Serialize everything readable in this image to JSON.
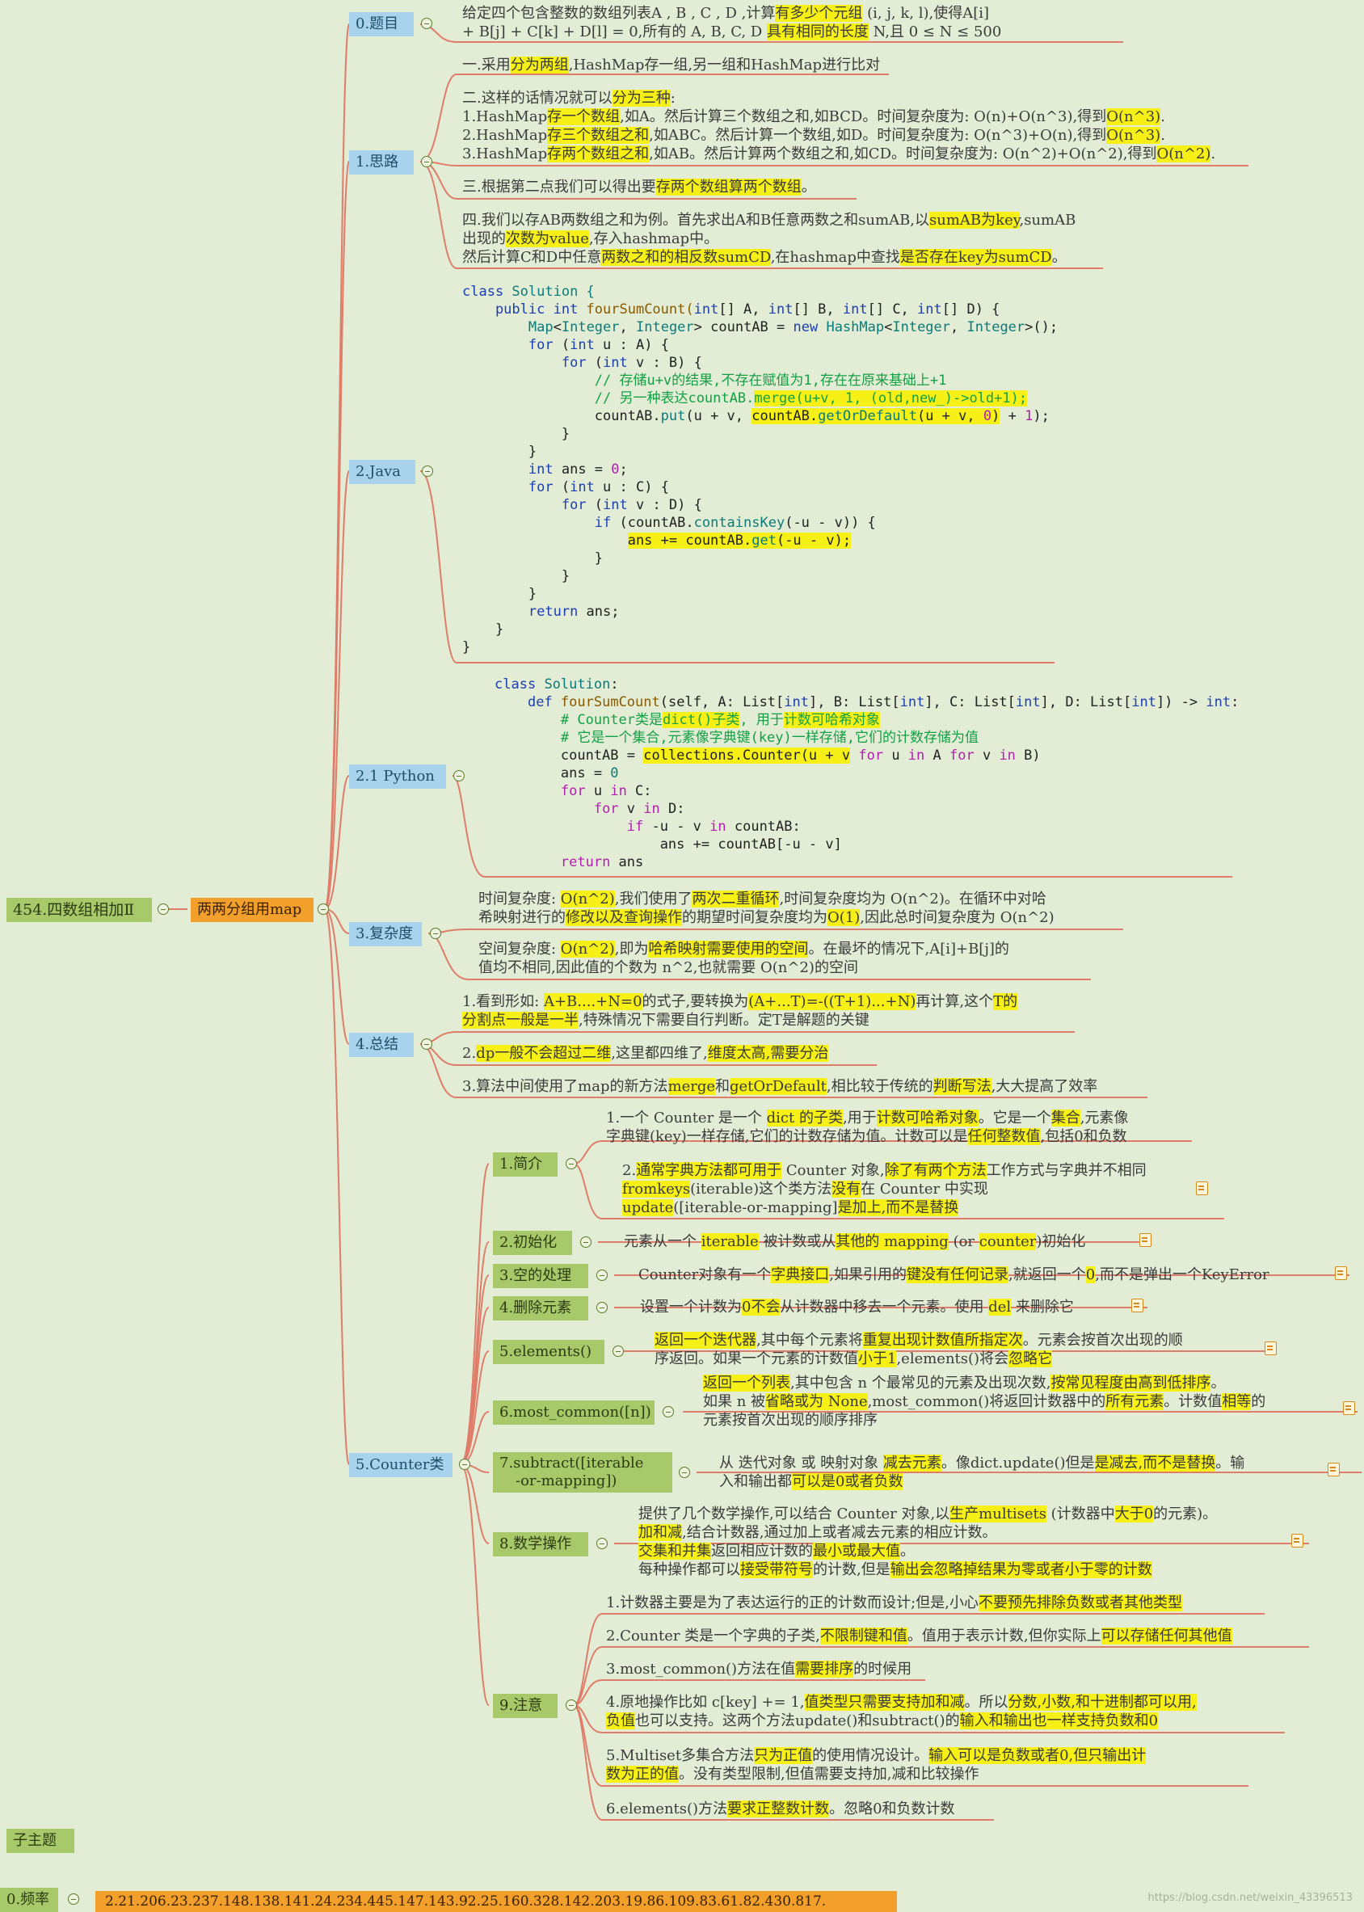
{
  "root": {
    "label": "454.四数组相加Ⅱ"
  },
  "hub": {
    "label": "两两分组用map"
  },
  "branches": {
    "title": "0.题目",
    "idea": "1.思路",
    "java": "2.Java",
    "python": "2.1 Python",
    "complexity": "3.复杂度",
    "summary": "4.总结",
    "counter": "5.Counter类"
  },
  "title_text": {
    "l1a": "给定四个包含整数的数组列表A , B , C , D ,计算",
    "l1b": "有多少个元组",
    "l1c": " (i, j, k, l),使得A[i]",
    "l2a": "+ B[j] + C[k] + D[l] = 0,所有的 A, B, C, D ",
    "l2b": "具有相同的长度",
    "l2c": " N,且 0 ≤ N ≤ 500"
  },
  "idea_text": {
    "p1a": "一.采用",
    "p1b": "分为两组",
    "p1c": ",HashMap存一组,另一组和HashMap进行比对",
    "p2a": "二.这样的话情况就可以",
    "p2b": "分为三种",
    "p2c": ":",
    "p2_1a": "1.HashMap",
    "p2_1b": "存一个数组",
    "p2_1c": ",如A。然后计算三个数组之和,如BCD。时间复杂度为: O(n)+O(n^3),得到",
    "p2_1d": "O(n^3)",
    "p2_1e": ".",
    "p2_2a": "2.HashMap",
    "p2_2b": "存三个数组之和",
    "p2_2c": ",如ABC。然后计算一个数组,如D。时间复杂度为: O(n^3)+O(n),得到",
    "p2_2d": "O(n^3)",
    "p2_2e": ".",
    "p2_3a": "3.HashMap",
    "p2_3b": "存两个数组之和",
    "p2_3c": ",如AB。然后计算两个数组之和,如CD。时间复杂度为: O(n^2)+O(n^2),得到",
    "p2_3d": "O(n^2)",
    "p2_3e": ".",
    "p3a": "三.根据第二点我们可以得出要",
    "p3b": "存两个数组算两个数组",
    "p3c": "。",
    "p4a": "四.我们以存AB两数组之和为例。首先求出A和B任意两数之和sumAB,以",
    "p4b": "sumAB为key",
    "p4c": ",sumAB",
    "p4d": "出现的",
    "p4e": "次数为value",
    "p4f": ",存入hashmap中。",
    "p4g": "然后计算C和D中任意",
    "p4h": "两数之和的相反数sumCD",
    "p4i": ",在hashmap中查找",
    "p4j": "是否存在key为sumCD",
    "p4k": "。"
  },
  "java_code": {
    "l1a": "class",
    "l1b": " Solution {",
    "l2a": "    public ",
    "l2b": "int",
    "l2c": " fourSumCount(",
    "l2d": "int",
    "l2e": "[] A, ",
    "l2f": "int",
    "l2g": "[] B, ",
    "l2h": "int",
    "l2i": "[] C, ",
    "l2j": "int",
    "l2k": "[] D) {",
    "l3a": "        ",
    "l3b": "Map",
    "l3c": "<",
    "l3d": "Integer",
    "l3e": ", ",
    "l3f": "Integer",
    "l3g": "> countAB = ",
    "l3h": "new",
    "l3i": " ",
    "l3j": "HashMap",
    "l3k": "<",
    "l3l": "Integer",
    "l3m": ", ",
    "l3n": "Integer",
    "l3o": ">();",
    "l4a": "        ",
    "l4b": "for",
    "l4c": " (",
    "l4d": "int",
    "l4e": " u : A) {",
    "l5a": "            ",
    "l5b": "for",
    "l5c": " (",
    "l5d": "int",
    "l5e": " v : B) {",
    "l6": "                // 存储u+v的结果,不存在赋值为1,存在在原来基础上+1",
    "l7a": "                // 另一种表达countAB.",
    "l7b": "merge(u+v, 1, (old,new_)->old+1);",
    "l8a": "                countAB.",
    "l8b": "put",
    "l8c": "(u + v, ",
    "l8d": "countAB.",
    "l8e": "getOrDefault",
    "l8f": "(u + v, ",
    "l8g": "0",
    "l8h": ")",
    "l8i": " + ",
    "l8j": "1",
    "l8k": ");",
    "l9": "            }",
    "l10": "        }",
    "l11a": "        ",
    "l11b": "int",
    "l11c": " ans = ",
    "l11d": "0",
    "l11e": ";",
    "l12a": "        ",
    "l12b": "for",
    "l12c": " (",
    "l12d": "int",
    "l12e": " u : C) {",
    "l13a": "            ",
    "l13b": "for",
    "l13c": " (",
    "l13d": "int",
    "l13e": " v : D) {",
    "l14a": "                ",
    "l14b": "if",
    "l14c": " (countAB.",
    "l14d": "containsKey",
    "l14e": "(-u - v)) {",
    "l15a": "                    ",
    "l15b": "ans += countAB.",
    "l15c": "get",
    "l15d": "(-u - v);",
    "l16": "                }",
    "l17": "            }",
    "l18": "        }",
    "l19a": "        ",
    "l19b": "return",
    "l19c": " ans;",
    "l20": "    }",
    "l21": "}"
  },
  "python_code": {
    "l1a": "class",
    "l1b": " ",
    "l1c": "Solution",
    "l1d": ":",
    "l2a": "    ",
    "l2b": "def",
    "l2c": " ",
    "l2d": "fourSumCount",
    "l2e": "(self, A: List[",
    "l2f": "int",
    "l2g": "], B: List[",
    "l2h": "int",
    "l2i": "], C: List[",
    "l2j": "int",
    "l2k": "], D: List[",
    "l2l": "int",
    "l2m": "]) -> ",
    "l2n": "int",
    "l2o": ":",
    "l3a": "        # Counter类是",
    "l3b": "dict()子类",
    "l3c": ", 用于",
    "l3d": "计数可哈希对象",
    "l4": "        # 它是一个集合,元素像字典键(key)一样存储,它们的计数存储为值",
    "l5a": "        countAB = ",
    "l5b": "collections.Counter(u + v",
    "l5c": " ",
    "l5d": "for",
    "l5e": " u ",
    "l5f": "in",
    "l5g": " A ",
    "l5h": "for",
    "l5i": " v ",
    "l5j": "in",
    "l5k": " B)",
    "l6a": "        ans = ",
    "l6b": "0",
    "l7a": "        ",
    "l7b": "for",
    "l7c": " u ",
    "l7d": "in",
    "l7e": " C:",
    "l8a": "            ",
    "l8b": "for",
    "l8c": " v ",
    "l8d": "in",
    "l8e": " D:",
    "l9a": "                ",
    "l9b": "if",
    "l9c": " -u - v ",
    "l9d": "in",
    "l9e": " countAB:",
    "l10": "                    ans += countAB[-u - v]",
    "l11a": "        ",
    "l11b": "return",
    "l11c": " ans"
  },
  "complexity_text": {
    "t1a": "时间复杂度: ",
    "t1b": "O(n^2)",
    "t1c": ",我们使用了",
    "t1d": "两次二重循环",
    "t1e": ",时间复杂度均为 O(n^2)。在循环中对哈",
    "t2a": "希映射进行的",
    "t2b": "修改以及查询操作",
    "t2c": "的期望时间复杂度均为",
    "t2d": "O(1)",
    "t2e": ",因此总时间复杂度为 O(n^2)",
    "s1a": "空间复杂度: ",
    "s1b": "O(n^2)",
    "s1c": ",即为",
    "s1d": "哈希映射需要使用的空间",
    "s1e": "。在最坏的情况下,A[i]+B[j]的",
    "s2": "值均不相同,因此值的个数为 n^2,也就需要 O(n^2)的空间"
  },
  "summary_text": {
    "a1a": "1.看到形如: ",
    "a1b": "A+B....+N=0",
    "a1c": "的式子,要转换为",
    "a1d": "(A+...T)=-((T+1)...+N)",
    "a1e": "再计算,这个",
    "a1f": "T的",
    "a2a": "分割点一般是一半",
    "a2b": ",特殊情况下需要自行判断。定T是解题的关键",
    "b1a": "2.",
    "b1b": "dp一般不会超过二维",
    "b1c": ",这里都四维了,",
    "b1d": "维度太高,需要分治",
    "c1a": "3.算法中间使用了map的新方法",
    "c1b": "merge",
    "c1c": "和",
    "c1d": "getOrDefault",
    "c1e": ",相比较于传统的",
    "c1f": "判断写法",
    "c1g": ",大大提高了效率"
  },
  "counter": {
    "intro": {
      "label": "1.简介",
      "a1a": "1.一个 Counter 是一个 ",
      "a1b": "dict 的子类",
      "a1c": ",用于",
      "a1d": "计数可哈希对象",
      "a1e": "。它是一个",
      "a1f": "集合",
      "a1g": ",元素像",
      "a2a": "字典键(key)一样存储,它们的计数存储为值。计数可以是",
      "a2b": "任何整数值",
      "a2c": ",包括0和负数",
      "b1a": "2.",
      "b1b": "通常字典方法都可用于",
      "b1c": " Counter 对象,",
      "b1d": "除了有两个方法",
      "b1e": "工作方式与字典并不相同",
      "b2a": "fromkeys",
      "b2b": "(iterable)这个类方法",
      "b2c": "没有",
      "b2d": "在 Counter 中实现",
      "b3a": "update",
      "b3b": "([iterable-or-mapping]",
      "b3c": "是加上,而不是替换"
    },
    "init": {
      "label": "2.初始化",
      "a": "元素从一个 ",
      "b": "iterable",
      "c": " 被计数或从",
      "d": "其他的 mapping",
      "e": " (or ",
      "f": "counter",
      "g": ")初始化"
    },
    "missing": {
      "label": "3.空的处理",
      "a": "Counter对象有一个",
      "b": "字典接口",
      "c": ",如果引用的",
      "d": "键没有任何记录",
      "e": ",就返回一个",
      "f": "0",
      "g": ",而不是弹出一个KeyError"
    },
    "delete": {
      "label": "4.删除元素",
      "a": "设置一个计数为",
      "b": "0不会",
      "c": "从计数器中移去一个元素。使用 ",
      "d": "del",
      "e": " 来删除它"
    },
    "elements": {
      "label": "5.elements()",
      "a1a": "返回一个迭代器",
      "a1b": ",其中每个元素将",
      "a1c": "重复出现计数值所指定次",
      "a1d": "。元素会按首次出现的顺",
      "a2a": "序返回。如果一个元素的计数值",
      "a2b": "小于1",
      "a2c": ",elements()将会",
      "a2d": "忽略它"
    },
    "most_common": {
      "label": "6.most_common([n])",
      "a1a": "返回一个列表",
      "a1b": ",其中包含 n 个最常见的元素及出现次数,",
      "a1c": "按常见程度由高到低排序",
      "a1d": "。",
      "a2a": "如果 n 被",
      "a2b": "省略或为 None",
      "a2c": ",most_common()将返回计数器中的",
      "a2d": "所有元素",
      "a2e": "。计数值",
      "a2f": "相等",
      "a2g": "的",
      "a3": "元素按首次出现的顺序排序"
    },
    "subtract": {
      "label1": "7.subtract([iterable",
      "label2": "-or-mapping])",
      "a1a": "从 迭代对象 或 映射对象 ",
      "a1b": "减去元素",
      "a1c": "。像dict.update()但是",
      "a1d": "是减去,而不是替换",
      "a1e": "。输",
      "a2a": "入和输出都",
      "a2b": "可以是0或者负数"
    },
    "math": {
      "label": "8.数学操作",
      "a1a": "提供了几个数学操作,可以结合 Counter 对象,以",
      "a1b": "生产multisets",
      "a1c": " (计数器中",
      "a1d": "大于0",
      "a1e": "的元素)。",
      "a2a": "加和减",
      "a2b": ",结合计数器,通过加上或者减去元素的相应计数。",
      "a3a": "交集和并集",
      "a3b": "返回相应计数的",
      "a3c": "最小或最大值",
      "a3d": "。",
      "a4a": "每种操作都可以",
      "a4b": "接受带符号",
      "a4c": "的计数,但是",
      "a4d": "输出会忽略掉结果为零或者小于零的计数"
    },
    "notes": {
      "label": "9.注意",
      "n1a": "1.计数器主要是为了表达运行的正的计数而设计;但是,小心",
      "n1b": "不要预先排除负数或者其他类型",
      "n2a": "2.Counter 类是一个字典的子类,",
      "n2b": "不限制键和值",
      "n2c": "。值用于表示计数,但你实际上",
      "n2d": "可以存储任何其他值",
      "n3a": "3.most_common()方法在值",
      "n3b": "需要排序",
      "n3c": "的时候用",
      "n4a": "4.原地操作比如 c[key] += 1,",
      "n4b": "值类型只需要支持加和减",
      "n4c": "。所以",
      "n4d": "分数,小数,和十进制都可以用,",
      "n4e": "负值",
      "n4f": "也可以支持。这两个方法update()和subtract()的",
      "n4g": "输入和输出也一样支持负数和0",
      "n5a": "5.Multiset多集合方法",
      "n5b": "只为正值",
      "n5c": "的使用情况设计。",
      "n5d": "输入可以是负数或者0,但只输出计",
      "n5e": "数为正的值",
      "n5f": "。没有类型限制,但值需要支持加,减和比较操作",
      "n6a": "6.elements()方法",
      "n6b": "要求正整数计数",
      "n6c": "。忽略0和负数计数"
    }
  },
  "subtopic": {
    "label": "子主题"
  },
  "frequency": {
    "label": "0.频率",
    "value": "2.21.206.23.237.148.138.141.24.234.445.147.143.92.25.160.328.142.203.19.86.109.83.61.82.430.817."
  },
  "watermark": "https://blog.csdn.net/weixin_43396513",
  "colors": {
    "background": "#e3ecd4",
    "branch_blue": "#a9d3ec",
    "branch_green": "#a8c96a",
    "hub_orange": "#f2a02b",
    "connector": "#e07d6a",
    "highlight": "#f6f016"
  }
}
